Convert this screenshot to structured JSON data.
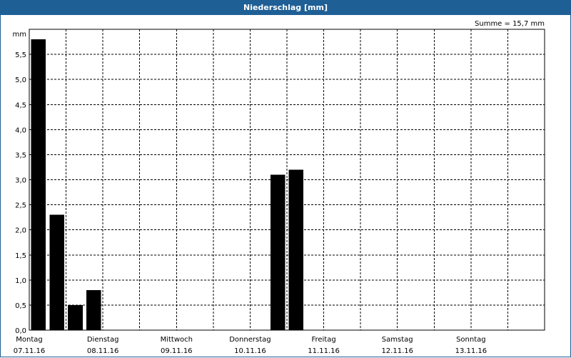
{
  "window": {
    "title": "Niederschlag [mm]"
  },
  "summary": "Summe = 15,7 mm",
  "chart_data": {
    "type": "bar",
    "title": "Niederschlag [mm]",
    "ylabel": "mm",
    "ylim": [
      0,
      6.0
    ],
    "y_ticks": [
      "0,0",
      "0,5",
      "1,0",
      "1,5",
      "2,0",
      "2,5",
      "3,0",
      "3,5",
      "4,0",
      "4,5",
      "5,0",
      "5,5"
    ],
    "grid": true,
    "grid_style": "dashed",
    "bar_color": "#000000",
    "x_range_days": [
      0,
      7
    ],
    "x_tick_labels": [
      {
        "day": "Montag",
        "date": "07.11.16"
      },
      {
        "day": "Dienstag",
        "date": "08.11.16"
      },
      {
        "day": "Mittwoch",
        "date": "09.11.16"
      },
      {
        "day": "Donnerstag",
        "date": "10.11.16"
      },
      {
        "day": "Freitag",
        "date": "11.11.16"
      },
      {
        "day": "Samstag",
        "date": "12.11.16"
      },
      {
        "day": "Sonntag",
        "date": "13.11.16"
      }
    ],
    "bars": [
      {
        "x": "07.11.16 03:00",
        "value": 5.8
      },
      {
        "x": "07.11.16 09:00",
        "value": 2.3
      },
      {
        "x": "07.11.16 15:00",
        "value": 0.5
      },
      {
        "x": "07.11.16 21:00",
        "value": 0.8
      },
      {
        "x": "10.11.16 09:00",
        "value": 3.1
      },
      {
        "x": "10.11.16 15:00",
        "value": 3.2
      }
    ]
  }
}
